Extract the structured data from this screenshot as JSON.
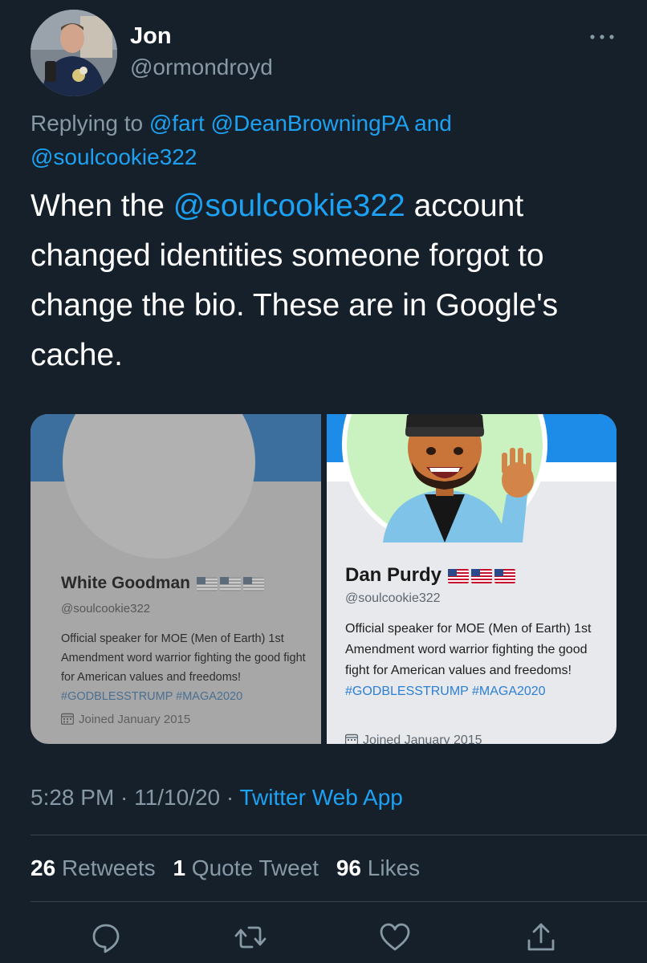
{
  "author": {
    "name": "Jon",
    "handle": "@ormondroyd"
  },
  "reply": {
    "prefix": "Replying to",
    "mention1": "@fart",
    "mention2": "@DeanBrowningPA",
    "conj": "and",
    "mention3": "@soulcookie322"
  },
  "body": {
    "part1": "When the ",
    "mention": "@soulcookie322",
    "part2": " account changed identities someone forgot to change the bio. These are in Google's cache."
  },
  "media": {
    "left": {
      "name": "White Goodman",
      "handle": "@soulcookie322",
      "bio": "Official speaker for MOE (Men of Earth) 1st Amendment word warrior fighting the good fight for American values and freedoms! ",
      "tags": "#GODBLESSTRUMP #MAGA2020",
      "joined": "Joined January 2015"
    },
    "right": {
      "name": "Dan Purdy",
      "handle": "@soulcookie322",
      "bio": "Official speaker for MOE (Men of Earth) 1st Amendment word warrior fighting the good fight for American values and freedoms! ",
      "tags": "#GODBLESSTRUMP #MAGA2020",
      "joined": "Joined January 2015"
    }
  },
  "meta": {
    "time": "5:28 PM",
    "sep1": " · ",
    "date": "11/10/20",
    "sep2": " · ",
    "app": "Twitter Web App"
  },
  "stats": {
    "retweets_count": "26",
    "retweets_label": "Retweets",
    "quotes_count": "1",
    "quotes_label": "Quote Tweet",
    "likes_count": "96",
    "likes_label": "Likes"
  },
  "icons": {
    "more": "more-horizontal-icon",
    "reply": "reply-icon",
    "retweet": "retweet-icon",
    "like": "heart-icon",
    "share": "share-icon",
    "calendar": "calendar-icon",
    "flag": "us-flag-icon"
  },
  "colors": {
    "background": "#15202b",
    "link": "#1da1f2",
    "secondary_text": "#8899a6",
    "divider": "#38444d"
  }
}
